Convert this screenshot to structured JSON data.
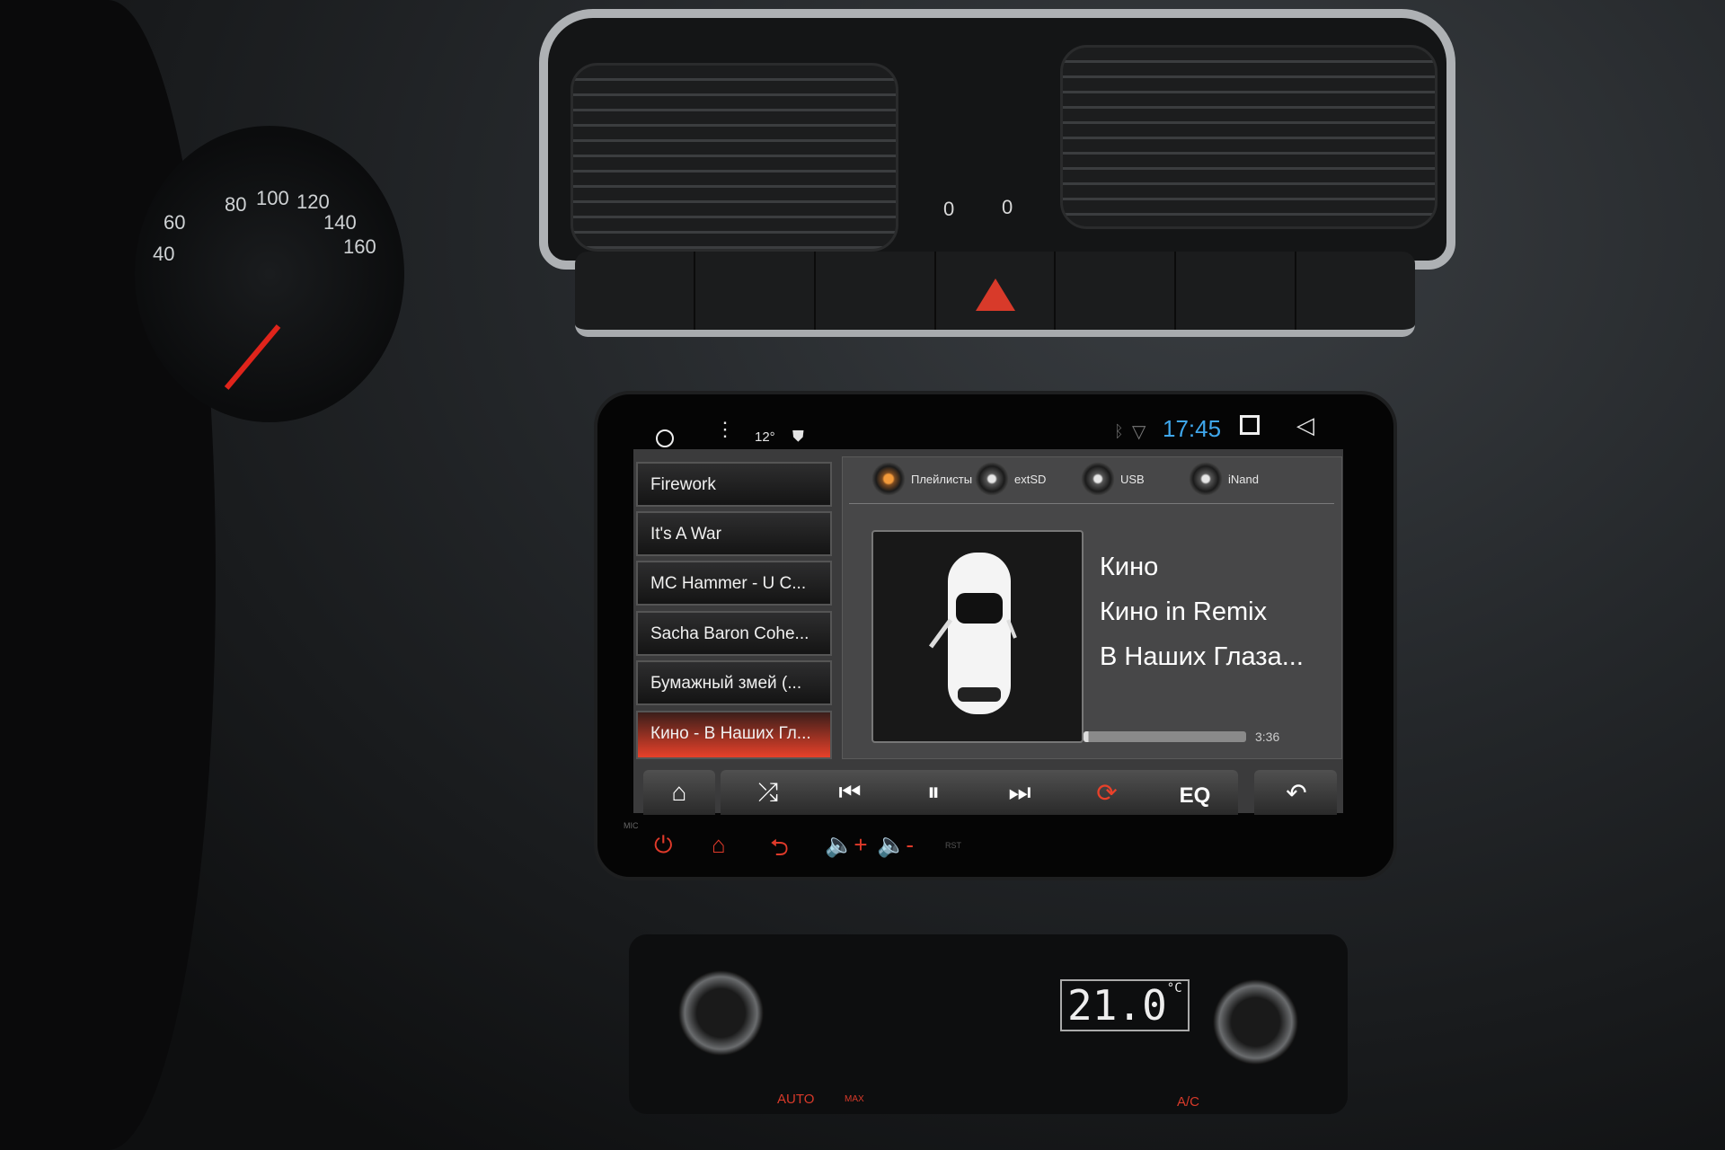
{
  "dashboard": {
    "speedometer_ticks": [
      "40",
      "60",
      "80",
      "100",
      "120",
      "140",
      "160"
    ],
    "vent_levels": [
      "0",
      "0"
    ],
    "climate": {
      "temperature": "21.0",
      "temperature_unit": "°C",
      "auto_label": "AUTO",
      "max_label": "MAX",
      "ac_label": "A/C"
    }
  },
  "status_bar": {
    "temperature": "12°",
    "clock": "17:45",
    "clock_color": "#3fa7ec",
    "icons": [
      "circle-home-icon",
      "menu-dots-icon",
      "shield-icon",
      "bluetooth-icon",
      "wifi-icon",
      "recents-square-icon",
      "back-triangle-icon"
    ]
  },
  "playlist": [
    {
      "title": "Firework",
      "active": false
    },
    {
      "title": "It's A War",
      "active": false
    },
    {
      "title": "MC Hammer - U C...",
      "active": false
    },
    {
      "title": "Sacha Baron Cohe...",
      "active": false
    },
    {
      "title": "Бумажный змей (...",
      "active": false
    },
    {
      "title": "Кино - В Наших Гл...",
      "active": true
    }
  ],
  "sources": [
    {
      "label": "Плейлисты",
      "selected": true
    },
    {
      "label": "extSD",
      "selected": false
    },
    {
      "label": "USB",
      "selected": false
    },
    {
      "label": "iNand",
      "selected": false
    }
  ],
  "now_playing": {
    "artist": "Кино",
    "album": "Кино in Remix",
    "title": "В Наших Глаза...",
    "duration": "3:36",
    "progress_percent": 3
  },
  "controls": {
    "eq_label": "EQ",
    "accent": "#e8412a"
  },
  "hardware": {
    "mic_label": "MIC",
    "rst_label": "RST"
  }
}
